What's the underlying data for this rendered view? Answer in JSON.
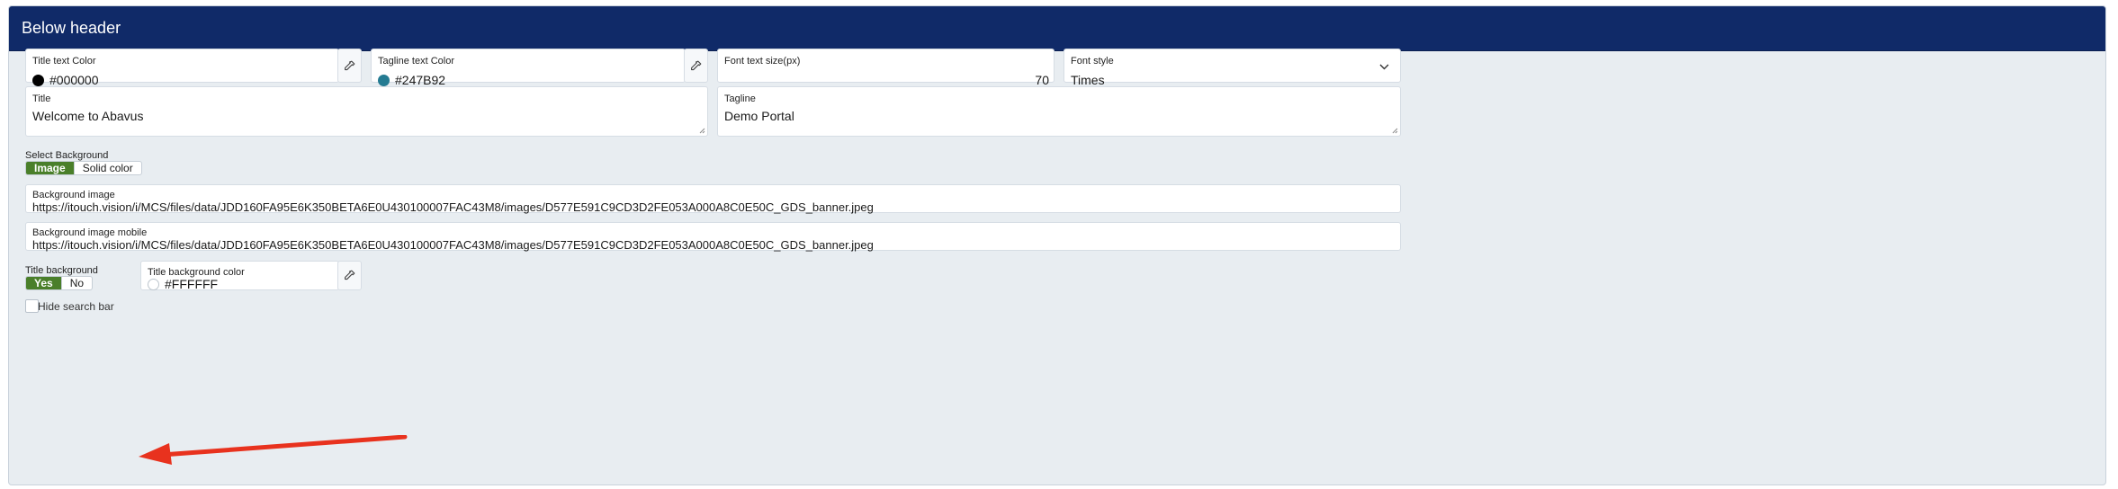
{
  "header": {
    "title": "Below header"
  },
  "title_color": {
    "label": "Title text Color",
    "value": "#000000",
    "swatch": "#000000"
  },
  "tagline_color": {
    "label": "Tagline text Color",
    "value": "#247B92",
    "swatch": "#247B92"
  },
  "font_size": {
    "label": "Font text size(px)",
    "value": "70"
  },
  "font_style": {
    "label": "Font style",
    "value": "Times"
  },
  "title": {
    "label": "Title",
    "value": "Welcome to Abavus"
  },
  "tagline": {
    "label": "Tagline",
    "value": "Demo Portal"
  },
  "background": {
    "label": "Select Background",
    "options": [
      "Image",
      "Solid color"
    ],
    "selected": "Image"
  },
  "bg_image": {
    "label": "Background image",
    "value": "https://itouch.vision/i/MCS/files/data/JDD160FA95E6K350BETA6E0U430100007FAC43M8/images/D577E591C9CD3D2FE053A000A8C0E50C_GDS_banner.jpeg"
  },
  "bg_image_mobile": {
    "label": "Background image mobile",
    "value": "https://itouch.vision/i/MCS/files/data/JDD160FA95E6K350BETA6E0U430100007FAC43M8/images/D577E591C9CD3D2FE053A000A8C0E50C_GDS_banner.jpeg"
  },
  "title_background": {
    "label": "Title background",
    "options": [
      "Yes",
      "No"
    ],
    "selected": "Yes"
  },
  "title_bg_color": {
    "label": "Title background color",
    "value": "#FFFFFF",
    "swatch": "#FFFFFF"
  },
  "hide_search": {
    "label": "Hide search bar",
    "checked": false
  },
  "colors": {
    "header_bg": "#102A68",
    "accent_green": "#4A7F2A",
    "annotation_arrow": "#E8321E"
  },
  "icons": {
    "picker": "eyedropper-icon",
    "dropdown": "chevron-down-icon"
  }
}
